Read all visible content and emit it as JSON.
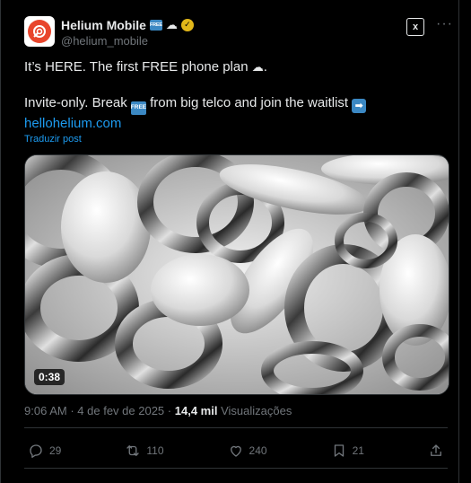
{
  "author": {
    "display_name": "Helium Mobile",
    "badge_free": "FREE",
    "handle": "@helium_mobile",
    "verified_color": "#e2b719"
  },
  "header_actions": {
    "grok_icon": "grok-icon",
    "grok_label": "x",
    "more_label": "···"
  },
  "tweet": {
    "line1_text": "It’s HERE. The first FREE phone plan ",
    "line1_end": ".",
    "line2_before": "Invite-only. Break ",
    "line2_after": " from big telco and join the waitlist ",
    "inline_free": "FREE",
    "arrow_glyph": "➡",
    "link": "hellohelium.com"
  },
  "translate_label": "Traduzir post",
  "media": {
    "duration": "0:38"
  },
  "meta": {
    "time": "9:06 AM",
    "dot": "·",
    "date": "4 de fev de 2025",
    "views_count": "14,4 mil",
    "views_label": "Visualizações"
  },
  "actions": {
    "replies": "29",
    "reposts": "110",
    "likes": "240",
    "bookmarks": "21"
  },
  "colors": {
    "accent": "#1d9bf0",
    "background": "#000000",
    "muted": "#71767b",
    "brand": "#e8452c"
  }
}
